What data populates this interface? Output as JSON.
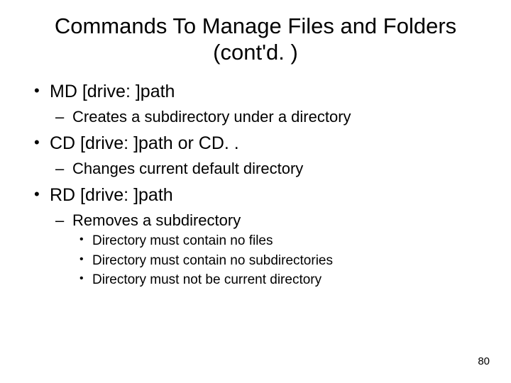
{
  "title": "Commands To Manage Files and Folders (cont'd. )",
  "items": [
    {
      "text": "MD [drive: ]path",
      "sub": [
        {
          "text": "Creates a subdirectory under a directory"
        }
      ]
    },
    {
      "text": "CD [drive: ]path or CD. .",
      "sub": [
        {
          "text": "Changes current default directory"
        }
      ]
    },
    {
      "text": "RD [drive: ]path",
      "sub": [
        {
          "text": "Removes a subdirectory",
          "sub": [
            {
              "text": "Directory must contain no files"
            },
            {
              "text": "Directory must contain no subdirectories"
            },
            {
              "text": "Directory must not be current directory"
            }
          ]
        }
      ]
    }
  ],
  "page_number": "80"
}
